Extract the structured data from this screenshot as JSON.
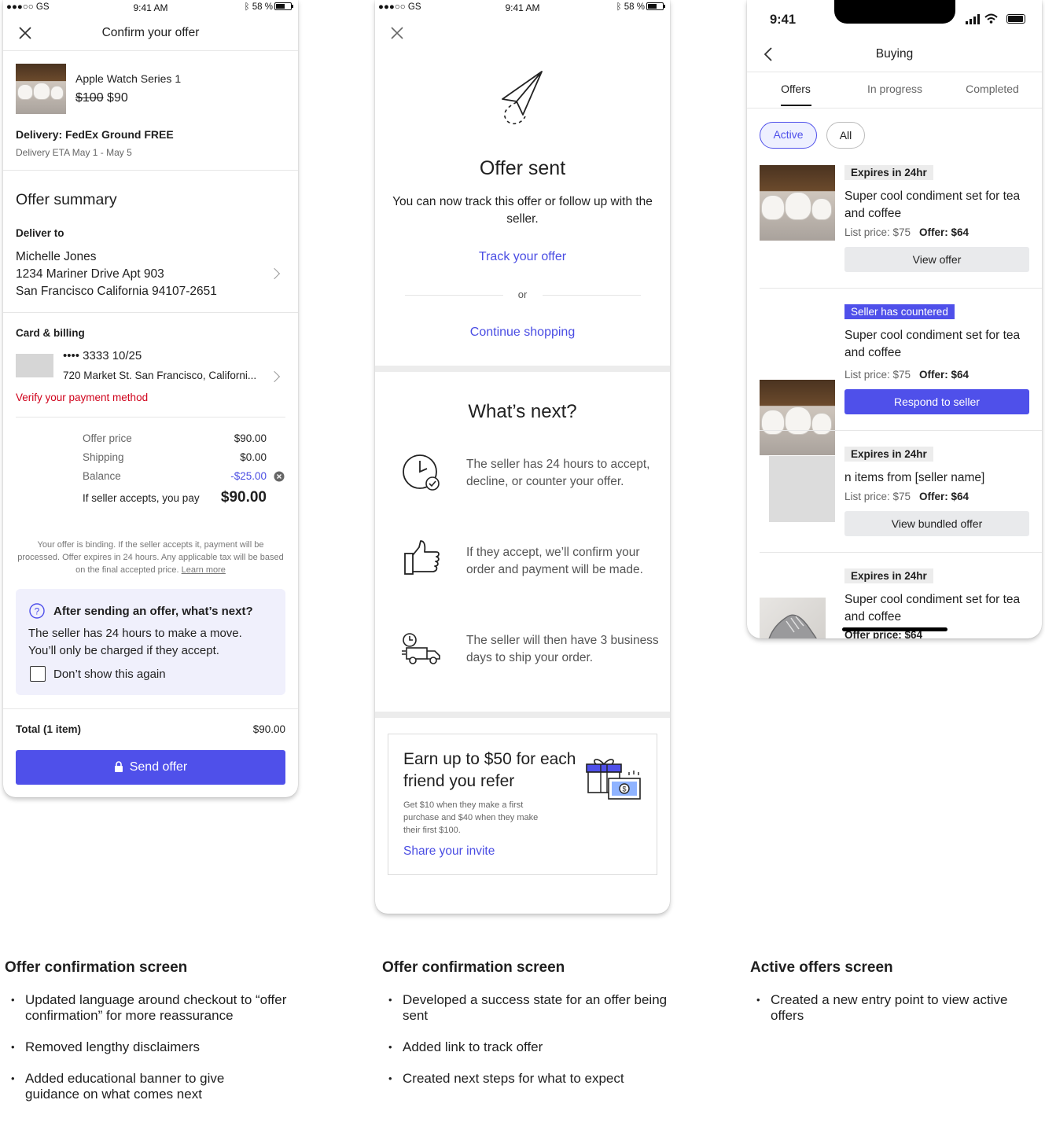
{
  "screen1": {
    "status": {
      "carrier": "●●●○○ GS",
      "time": "9:41 AM",
      "battery": "58 %"
    },
    "title": "Confirm your offer",
    "item_name": "Apple Watch Series 1",
    "original_price": "$100",
    "offer_price": "$90",
    "delivery": "Delivery: FedEx Ground FREE",
    "delivery_eta": "Delivery ETA May 1 - May 5",
    "summary_title": "Offer summary",
    "deliver_to_label": "Deliver to",
    "address_name": "Michelle Jones",
    "address_line1": "1234 Mariner Drive Apt 903",
    "address_line2": "San Francisco California 94107-2651",
    "card_label": "Card & billing",
    "card_number": "•••• 3333 10/25",
    "card_address": "720 Market St. San Francisco, Californi...",
    "verify_link": "Verify your payment method",
    "rows": [
      {
        "label": "Offer price",
        "value": "$90.00"
      },
      {
        "label": "Shipping",
        "value": "$0.00"
      },
      {
        "label": "Balance",
        "value": "-$25.00"
      }
    ],
    "pay_label": "If seller accepts, you pay",
    "pay_value": "$90.00",
    "disclaimer": "Your offer is binding. If the seller accepts it, payment will be processed. Offer expires in 24 hours. Any applicable tax will be based on the final accepted price.",
    "learn_more": "Learn more",
    "banner_title": "After sending an offer, what’s next?",
    "banner_body": "The seller has 24 hours to make a move. You’ll only be charged if they accept.",
    "banner_checkbox": "Don’t show this again",
    "total_label": "Total (1 item)",
    "total_value": "$90.00",
    "send_button": "Send offer"
  },
  "screen2": {
    "status": {
      "carrier": "●●●○○ GS",
      "time": "9:41 AM",
      "battery": "58 %"
    },
    "title": "Offer sent",
    "subtitle": "You can now track this offer or follow up with the seller.",
    "track_link": "Track your offer",
    "or": "or",
    "continue_link": "Continue shopping",
    "next_title": "What’s next?",
    "steps": [
      {
        "icon": "clock-check-icon",
        "text": "The seller has 24 hours to accept, decline, or counter your offer."
      },
      {
        "icon": "thumbs-up-icon",
        "text": "If they accept, we’ll confirm your order and payment will be made."
      },
      {
        "icon": "delivery-truck-icon",
        "text": "The seller will then have 3 business days to ship your order."
      }
    ],
    "refer_title": "Earn up to $50 for each friend you refer",
    "refer_body": "Get $10 when they make a first purchase and $40 when they make their first $100.",
    "refer_link": "Share your invite"
  },
  "screen3": {
    "status": {
      "time": "9:41"
    },
    "title": "Buying",
    "tabs": [
      "Offers",
      "In progress",
      "Completed"
    ],
    "filters": [
      "Active",
      "All"
    ],
    "offers": [
      {
        "tag": "Expires in 24hr",
        "title": "Super cool condiment set for tea and coffee",
        "list_price": "List price: $75",
        "offer": "Offer: $64",
        "button": "View offer"
      },
      {
        "tag": "Seller has countered",
        "title": "Super cool condiment set for tea and coffee",
        "list_price": "List price: $75",
        "offer": "Offer: $64",
        "button": "Respond to seller"
      },
      {
        "tag": "Expires in 24hr",
        "title": "n items from [seller name]",
        "list_price": "List price: $75",
        "offer": "Offer: $64",
        "button": "View bundled offer"
      },
      {
        "tag": "Expires in 24hr",
        "title": "Super cool condiment set for tea and coffee",
        "offer_partial": "Offer price: $64"
      }
    ]
  },
  "notes": [
    {
      "title": "Offer confirmation screen",
      "bullets": [
        "Updated language around checkout to “offer confirmation” for more reassurance",
        "Removed lengthy disclaimers",
        "Added educational banner to give guidance on what comes next"
      ]
    },
    {
      "title": "Offer confirmation screen",
      "bullets": [
        "Developed a success state for an offer being sent",
        "Added link to track offer",
        "Created next steps for what to expect"
      ]
    },
    {
      "title": "Active offers screen",
      "bullets": [
        "Created a new entry point to view active offers"
      ]
    }
  ],
  "colors": {
    "accent": "#4f50ea",
    "error": "#d0021b",
    "banner": "#f0f0fc"
  }
}
